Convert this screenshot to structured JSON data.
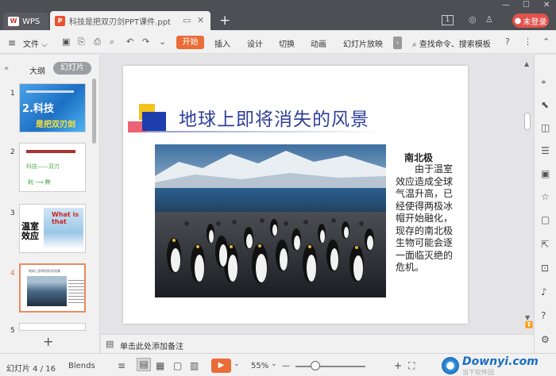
{
  "titlebar": {
    "app_tab": "WPS",
    "app_logo": "W",
    "doc_tab_icon": "P",
    "doc_title": "科技是把双刃剑PPT课件.ppt",
    "badge": "1",
    "login_label": "未登录",
    "icons": [
      "monitor-icon",
      "close-icon",
      "add-tab-icon",
      "minimize-icon",
      "maximize-icon",
      "window-close-icon",
      "skin-icon",
      "shirt-icon"
    ]
  },
  "ribbon": {
    "menu_glyph": "≡",
    "file_label": "文件",
    "tabs": [
      "开始",
      "插入",
      "设计",
      "切换",
      "动画",
      "幻灯片放映"
    ],
    "active_tab": "开始",
    "search_label": "查找命令、搜索模板",
    "accent": "#ea6c36"
  },
  "left_panel": {
    "tab_outline": "大纲",
    "tab_slides": "幻灯片",
    "numbers": [
      "1",
      "2",
      "3",
      "4",
      "5"
    ],
    "thumb1_title": "2.科技",
    "thumb1_sub": "是把双刃剑",
    "thumb2_line1": "科技——双刃",
    "thumb2_line2": "利   ⟶   弊",
    "thumb3_left": "温室效应",
    "thumb3_right": "What is that",
    "thumb4_title": "地球上即将消失的风景",
    "add_glyph": "+"
  },
  "slide": {
    "title": "地球上即将消失的风景",
    "side_title": "南北极",
    "side_text": "由于温室效应造成全球气温升高，已经使得两极冰帽开始融化，现存的南北极生物可能会逐一面临灭绝的危机。"
  },
  "notes": {
    "placeholder": "单击此处添加备注"
  },
  "status": {
    "slide_counter": "幻灯片 4 / 16",
    "theme": "Blends",
    "zoom": "55%",
    "zoom_fraction": 0.28,
    "minus": "—",
    "plus": "+",
    "watermark_name": "Downyi.com",
    "watermark_sub": "当下软件园"
  }
}
